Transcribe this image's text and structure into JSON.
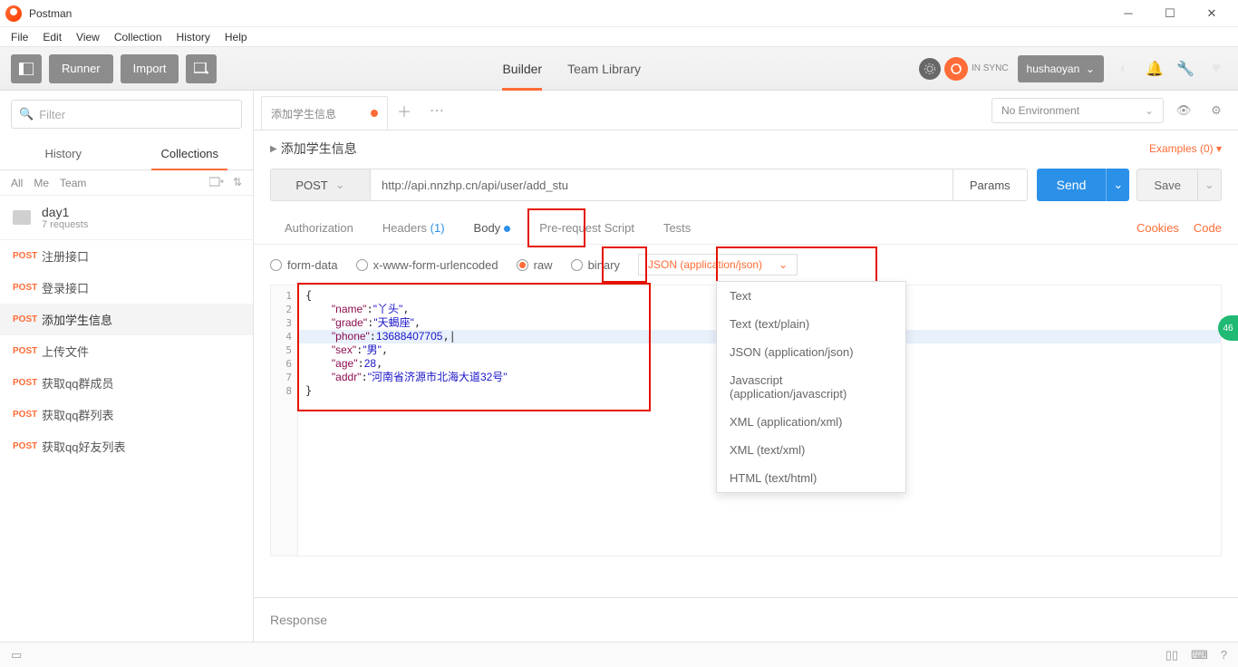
{
  "window": {
    "title": "Postman"
  },
  "menu": {
    "items": [
      "File",
      "Edit",
      "View",
      "Collection",
      "History",
      "Help"
    ]
  },
  "topbar": {
    "runner": "Runner",
    "import": "Import",
    "builder": "Builder",
    "team": "Team Library",
    "sync": "IN SYNC",
    "user": "hushaoyan"
  },
  "sidebar": {
    "filter_placeholder": "Filter",
    "tabs": {
      "history": "History",
      "collections": "Collections"
    },
    "scope": {
      "all": "All",
      "me": "Me",
      "team": "Team"
    },
    "collection": {
      "name": "day1",
      "sub": "7 requests"
    },
    "requests": [
      {
        "method": "POST",
        "name": "注册接口"
      },
      {
        "method": "POST",
        "name": "登录接口"
      },
      {
        "method": "POST",
        "name": "添加学生信息"
      },
      {
        "method": "POST",
        "name": "上传文件"
      },
      {
        "method": "POST",
        "name": "获取qq群成员"
      },
      {
        "method": "POST",
        "name": "获取qq群列表"
      },
      {
        "method": "POST",
        "name": "获取qq好友列表"
      }
    ]
  },
  "tabs": {
    "active_tab": "添加学生信息",
    "env_placeholder": "No Environment"
  },
  "request": {
    "title": "添加学生信息",
    "method": "POST",
    "url": "http://api.nnzhp.cn/api/user/add_stu",
    "params_btn": "Params",
    "send": "Send",
    "save": "Save",
    "examples": "Examples (0)"
  },
  "subtabs": {
    "auth": "Authorization",
    "headers": "Headers",
    "headers_count": "(1)",
    "body": "Body",
    "prereq": "Pre-request Script",
    "tests": "Tests",
    "cookies": "Cookies",
    "code": "Code"
  },
  "body_opts": {
    "formdata": "form-data",
    "urlencoded": "x-www-form-urlencoded",
    "raw": "raw",
    "binary": "binary",
    "content_type": "JSON (application/json)"
  },
  "content_type_menu": [
    "Text",
    "Text (text/plain)",
    "JSON (application/json)",
    "Javascript (application/javascript)",
    "XML (application/xml)",
    "XML (text/xml)",
    "HTML (text/html)"
  ],
  "editor": {
    "lines": [
      "1",
      "2",
      "3",
      "4",
      "5",
      "6",
      "7",
      "8"
    ],
    "body": {
      "name": "丫头",
      "grade": "天蝎座",
      "phone": 13688407705,
      "sex": "男",
      "age": 28,
      "addr": "河南省济源市北海大道32号"
    }
  },
  "response": {
    "label": "Response"
  },
  "side_badge": "46"
}
